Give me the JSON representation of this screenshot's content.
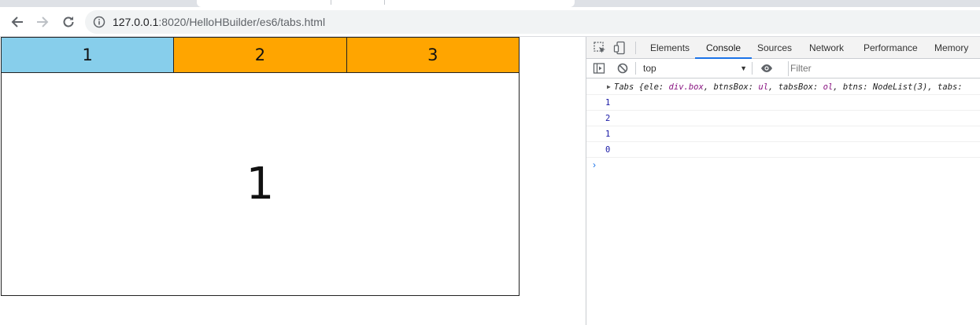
{
  "browser": {
    "url_host": "127.0.0.1",
    "url_rest": ":8020/HelloHBuilder/es6/tabs.html"
  },
  "page": {
    "tabs": [
      {
        "label": "1",
        "state": "active"
      },
      {
        "label": "2",
        "state": "inactive"
      },
      {
        "label": "3",
        "state": "inactive"
      }
    ],
    "panel_content": "1",
    "colors": {
      "active_tab": "#87ceeb",
      "inactive_tab": "#ffa500"
    }
  },
  "devtools": {
    "tabs": [
      "Elements",
      "Console",
      "Sources",
      "Network",
      "Performance",
      "Memory"
    ],
    "selected_tab": "Console",
    "context": "top",
    "filter_placeholder": "Filter",
    "log": {
      "object_prefix": "Tabs {",
      "pairs": [
        {
          "key": "ele: ",
          "val": "div.box",
          "sep": ", "
        },
        {
          "key": "btnsBox: ",
          "val": "ul",
          "sep": ", "
        },
        {
          "key": "tabsBox: ",
          "val": "ol",
          "sep": ", "
        },
        {
          "key": "btns: ",
          "val": "NodeList(3)",
          "sep": ", "
        },
        {
          "key": "tabs: ",
          "val": "",
          "sep": ""
        }
      ],
      "numbers": [
        "1",
        "2",
        "1",
        "0"
      ]
    },
    "prompt": "›"
  }
}
